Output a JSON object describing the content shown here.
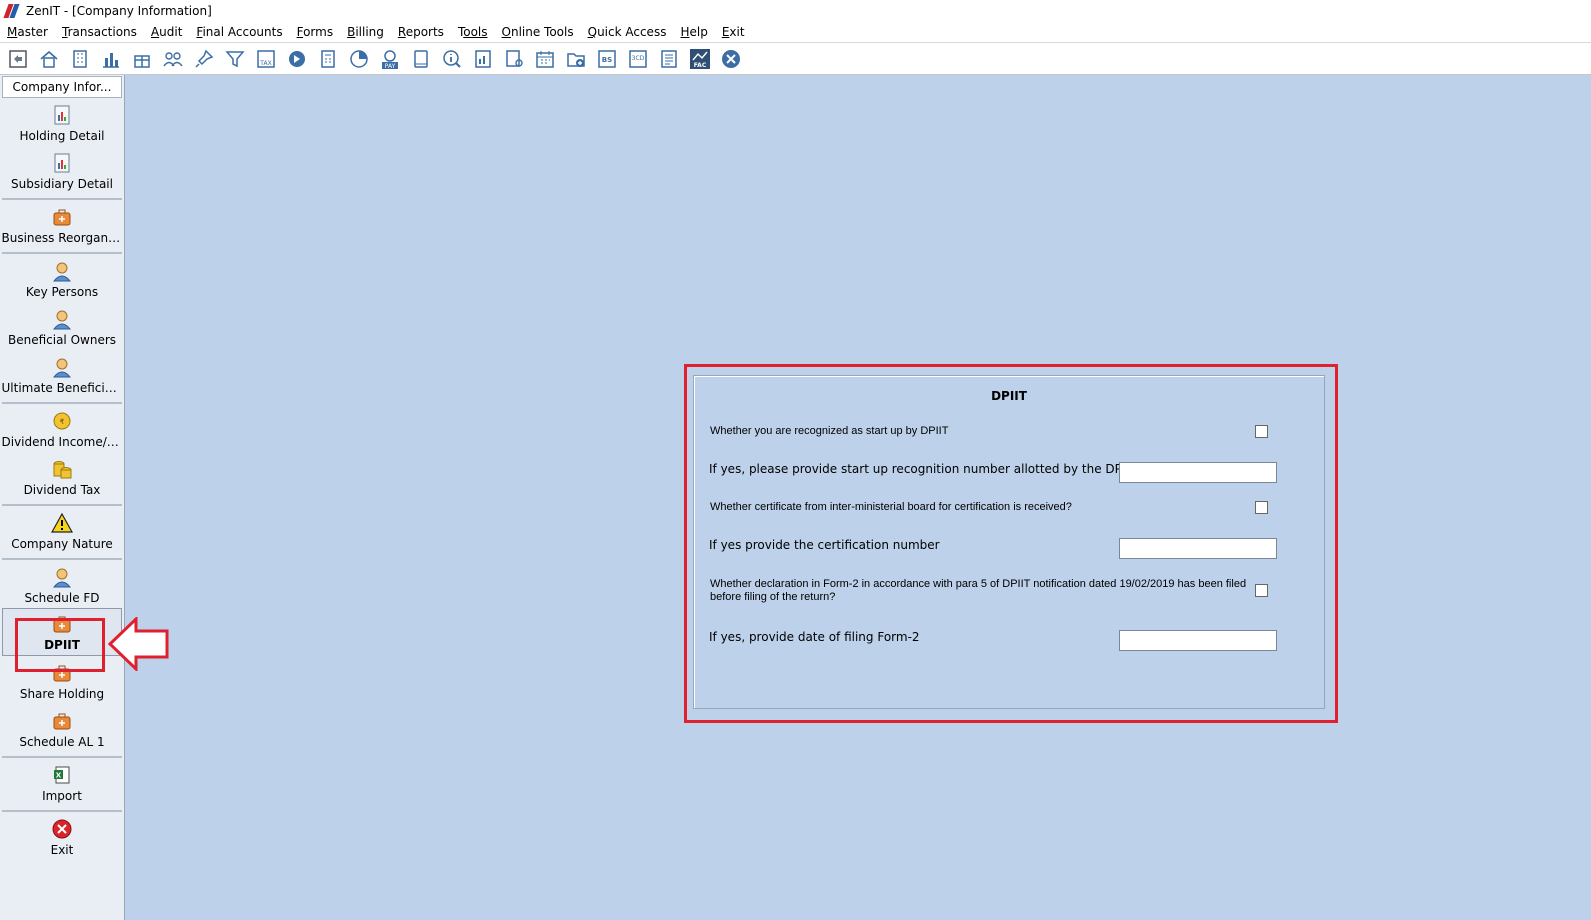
{
  "window": {
    "title": "ZenIT - [Company Information]"
  },
  "menu": [
    {
      "u": "M",
      "rest": "aster"
    },
    {
      "u": "T",
      "rest": "ransactions"
    },
    {
      "u": "A",
      "rest": "udit"
    },
    {
      "u": "F",
      "rest": "inal Accounts",
      "pre": ""
    },
    {
      "u": "F",
      "rest": "orms"
    },
    {
      "u": "B",
      "rest": "illing"
    },
    {
      "u": "R",
      "rest": "eports"
    },
    {
      "u": "T",
      "rest": "ools"
    },
    {
      "u": "O",
      "rest": "nline Tools"
    },
    {
      "u": "Q",
      "rest": "uick Access"
    },
    {
      "u": "H",
      "rest": "elp"
    },
    {
      "u": "E",
      "rest": "xit"
    }
  ],
  "menu_labels": [
    "Master",
    "Transactions",
    "Audit",
    "Final Accounts",
    "Forms",
    "Billing",
    "Reports",
    "Tools",
    "Online Tools",
    "Quick Access",
    "Help",
    "Exit"
  ],
  "toolbar_icons": [
    "return-icon",
    "home-icon",
    "building-icon",
    "bar-chart-icon",
    "gift-icon",
    "group-icon",
    "pin-icon",
    "filter-icon",
    "tax-icon",
    "arrow-circle-icon",
    "calculator-icon",
    "pie-chart-icon",
    "pay-icon",
    "book-icon",
    "info-icon",
    "report-icon",
    "user-report-icon",
    "calendar-icon",
    "folder-add-icon",
    "bs-icon",
    "3cd-icon",
    "document-icon",
    "fac-icon",
    "close-circle-icon"
  ],
  "toolbar_text": {
    "tax": "TAX",
    "pay": "PAY",
    "bs": "BS",
    "cd": "3CD",
    "fac": "FAC"
  },
  "sidebar": {
    "header": "Company Infor...",
    "items": [
      {
        "label": "Holding Detail"
      },
      {
        "label": "Subsidiary Detail"
      },
      {
        "label": "Business Reorganis..."
      },
      {
        "label": "Key Persons"
      },
      {
        "label": "Beneficial Owners"
      },
      {
        "label": "Ultimate Beneficial ..."
      },
      {
        "label": "Dividend Income/P..."
      },
      {
        "label": "Dividend Tax"
      },
      {
        "label": "Company Nature"
      },
      {
        "label": "Schedule FD"
      },
      {
        "label": "DPIIT"
      },
      {
        "label": "Share Holding"
      },
      {
        "label": "Schedule AL 1"
      },
      {
        "label": "Import"
      },
      {
        "label": "Exit"
      }
    ]
  },
  "form": {
    "title": "DPIIT",
    "q1": "Whether you are recognized as start up by DPIIT",
    "q2": "If yes, please provide start up recognition number allotted by the DPIIT",
    "q3": "Whether certificate from inter-ministerial board for certification is received?",
    "q4": "If yes provide the certification number",
    "q5a": "Whether declaration in Form-2 in accordance with para 5 of DPIIT notification dated 19/02/2019 has been filed",
    "q5b": "before filing of the return?",
    "q6": "If yes, provide date of filing Form-2",
    "q2_value": "",
    "q4_value": "",
    "q6_value": ""
  },
  "colors": {
    "background": "#bdd1ea",
    "highlight": "#e0202e"
  }
}
